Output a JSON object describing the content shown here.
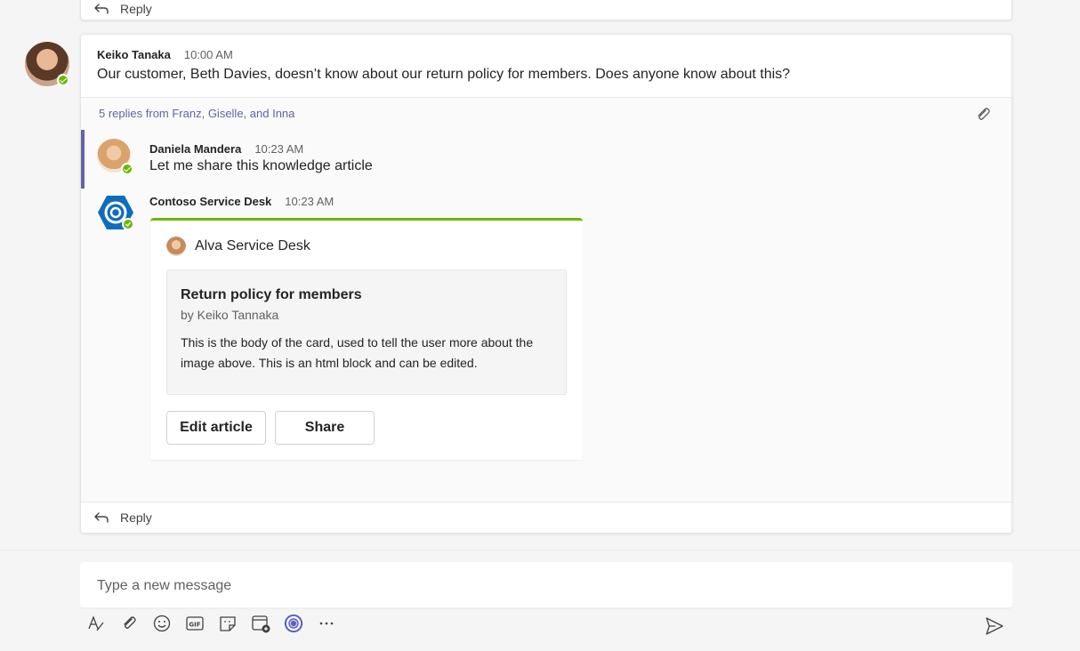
{
  "top_reply": {
    "label": "Reply"
  },
  "root_message": {
    "author": "Keiko Tanaka",
    "time": "10:00 AM",
    "text": "Our customer, Beth Davies, doesn’t know about our return policy for members. Does anyone know about this?"
  },
  "replies_summary": "5 replies from Franz, Giselle, and Inna",
  "replies": [
    {
      "author": "Daniela Mandera",
      "time": "10:23 AM",
      "text": "Let me share this knowledge article"
    },
    {
      "author": "Contoso Service Desk",
      "time": "10:23 AM"
    }
  ],
  "card": {
    "source": "Alva Service Desk",
    "title": "Return policy for members",
    "byline": "by Keiko Tannaka",
    "body": "This is the body of the card, used to tell the user more about the image above. This is an html block and can be edited.",
    "buttons": {
      "edit": "Edit article",
      "share": "Share"
    }
  },
  "thread_reply": {
    "label": "Reply"
  },
  "compose": {
    "placeholder": "Type a new message"
  },
  "toolbar": {
    "icons": [
      "format-icon",
      "attach-icon",
      "emoji-icon",
      "gif-icon",
      "sticker-icon",
      "schedule-meeting-icon",
      "service-desk-app-icon",
      "more-options-icon",
      "send-icon"
    ]
  },
  "colors": {
    "accent": "#6264a7",
    "presence": "#6bb700",
    "card_border": "#6bb700"
  }
}
